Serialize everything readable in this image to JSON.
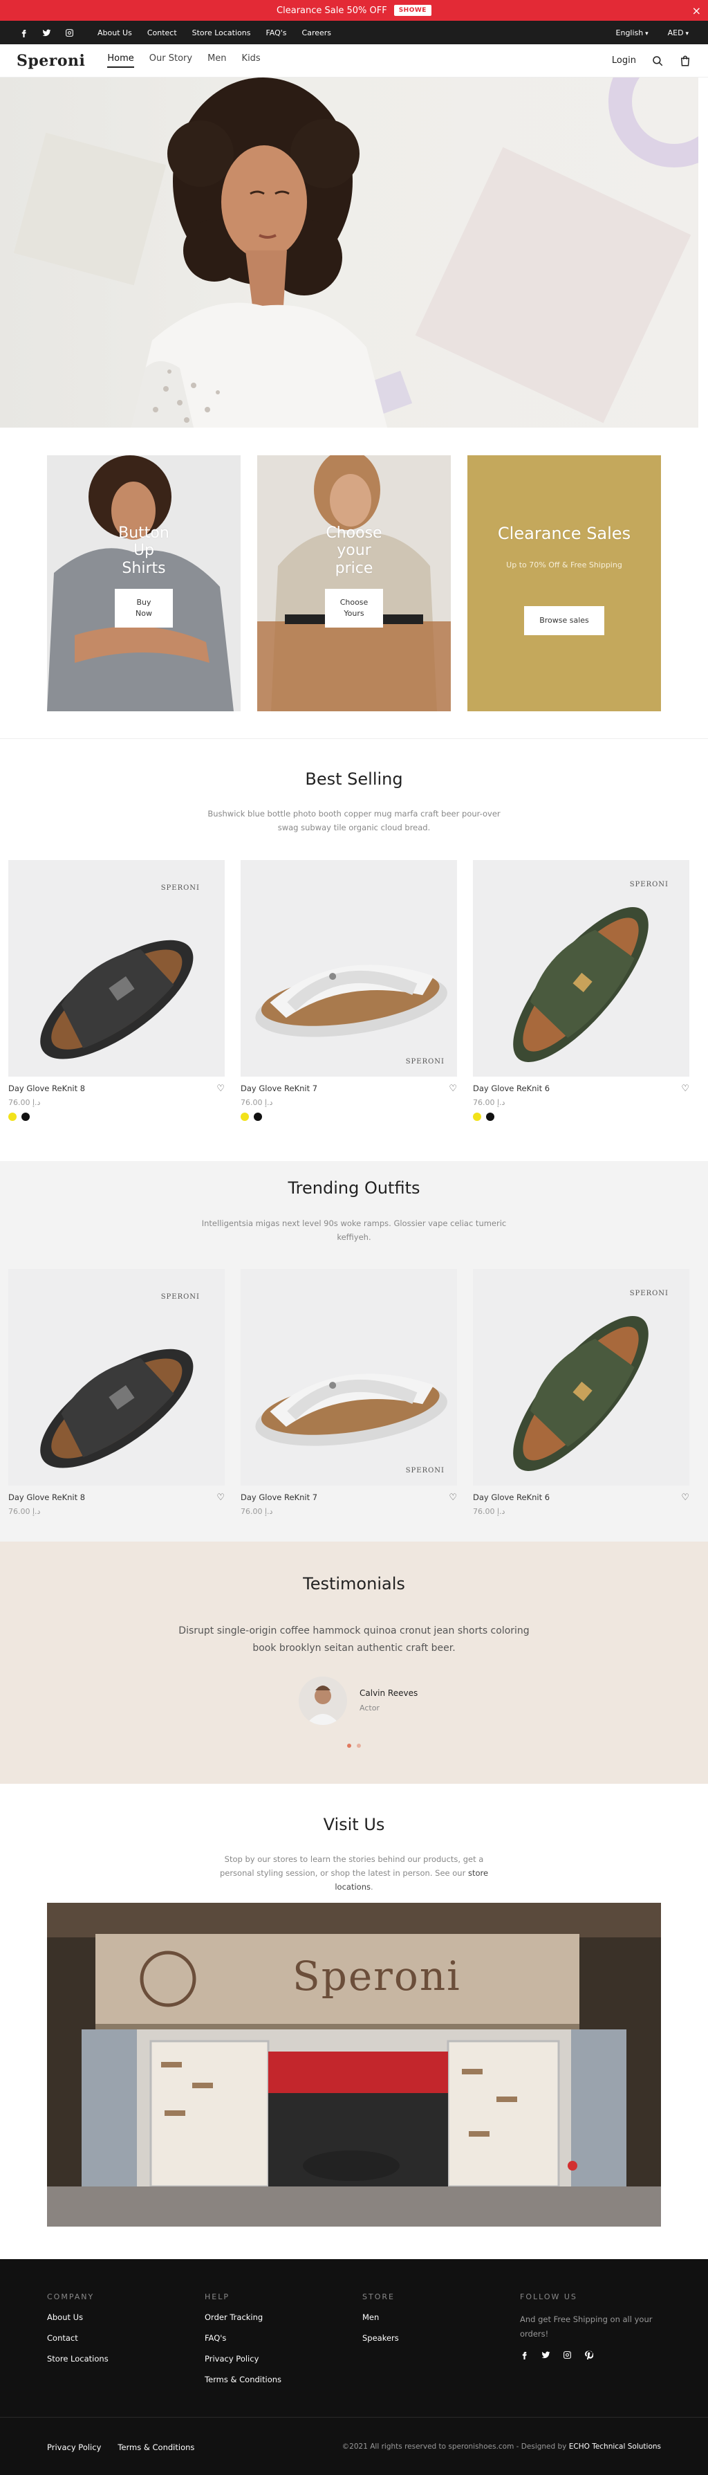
{
  "announcement": {
    "text": "Clearance Sale 50% OFF",
    "cta": "SHOWE",
    "close": "×"
  },
  "topbar": {
    "social": [
      "facebook-icon",
      "twitter-icon",
      "instagram-icon"
    ],
    "links": [
      "About Us",
      "Contect",
      "Store Locations",
      "FAQ's",
      "Careers"
    ],
    "language": "English",
    "currency": "AED"
  },
  "header": {
    "logo": "Speroni",
    "nav": [
      "Home",
      "Our Story",
      "Men",
      "Kids"
    ],
    "login": "Login"
  },
  "promos": {
    "p1": {
      "title_lines": [
        "Button",
        "Up",
        "Shirts"
      ],
      "button_lines": [
        "Buy",
        "Now"
      ]
    },
    "p2": {
      "title_lines": [
        "Choose",
        "your",
        "price"
      ],
      "button_lines": [
        "Choose",
        "Yours"
      ]
    },
    "p3": {
      "title": "Clearance Sales",
      "subtitle": "Up to 70% Off & Free Shipping",
      "button": "Browse sales"
    }
  },
  "best_selling": {
    "title": "Best Selling",
    "description": "Bushwick blue bottle photo booth copper mug marfa craft beer pour-over swag subway tile organic cloud bread.",
    "products": [
      {
        "name": "Day Glove ReKnit 8",
        "price": "76.00 د.إ",
        "brand": "SPERONI",
        "swatches": [
          "#f2e21a",
          "#111111"
        ]
      },
      {
        "name": "Day Glove ReKnit 7",
        "price": "76.00 د.إ",
        "brand": "SPERONI",
        "swatches": [
          "#f2e21a",
          "#111111"
        ]
      },
      {
        "name": "Day Glove ReKnit 6",
        "price": "76.00 د.إ",
        "brand": "SPERONI",
        "swatches": [
          "#f2e21a",
          "#111111"
        ]
      }
    ]
  },
  "trending": {
    "title": "Trending Outfits",
    "description": "Intelligentsia migas next level 90s woke ramps. Glossier vape celiac tumeric keffiyeh.",
    "products": [
      {
        "name": "Day Glove ReKnit 8",
        "price": "76.00 د.إ",
        "brand": "SPERONI"
      },
      {
        "name": "Day Glove ReKnit 7",
        "price": "76.00 د.إ",
        "brand": "SPERONI"
      },
      {
        "name": "Day Glove ReKnit 6",
        "price": "76.00 د.إ",
        "brand": "SPERONI"
      }
    ]
  },
  "testimonials": {
    "title": "Testimonials",
    "quote": "Disrupt single-origin coffee hammock quinoa cronut jean shorts coloring book brooklyn seitan authentic craft beer.",
    "name": "Calvin Reeves",
    "role": "Actor"
  },
  "visit": {
    "title": "Visit Us",
    "description_before": "Stop by our stores to learn the stories behind our products, get a personal styling session, or shop the latest in person. See our ",
    "description_link": "store locations",
    "description_after": ".",
    "store_sign": "Speroni"
  },
  "footer": {
    "company": {
      "heading": "COMPANY",
      "links": [
        "About Us",
        "Contact",
        "Store Locations"
      ]
    },
    "help": {
      "heading": "HELP",
      "links": [
        "Order Tracking",
        "FAQ's",
        "Privacy Policy",
        "Terms & Conditions"
      ]
    },
    "store": {
      "heading": "STORE",
      "links": [
        "Men",
        "Speakers"
      ]
    },
    "follow": {
      "heading": "FOLLOW US",
      "text": "And get Free Shipping on all your orders!",
      "icons": [
        "facebook-icon",
        "twitter-icon",
        "instagram-icon",
        "pinterest-icon"
      ]
    },
    "legal": [
      "Privacy Policy",
      "Terms & Conditions"
    ],
    "copyright": "©2021 All rights reserved to speronishoes.com - Designed by ",
    "designer": "ECHO Technical Solutions"
  },
  "colors": {
    "announcement": "#e32a36",
    "topbar": "#1d1d1d",
    "promo_gold": "#c4a85c",
    "testimonial_bg": "#efe7df",
    "footer": "#111111"
  }
}
